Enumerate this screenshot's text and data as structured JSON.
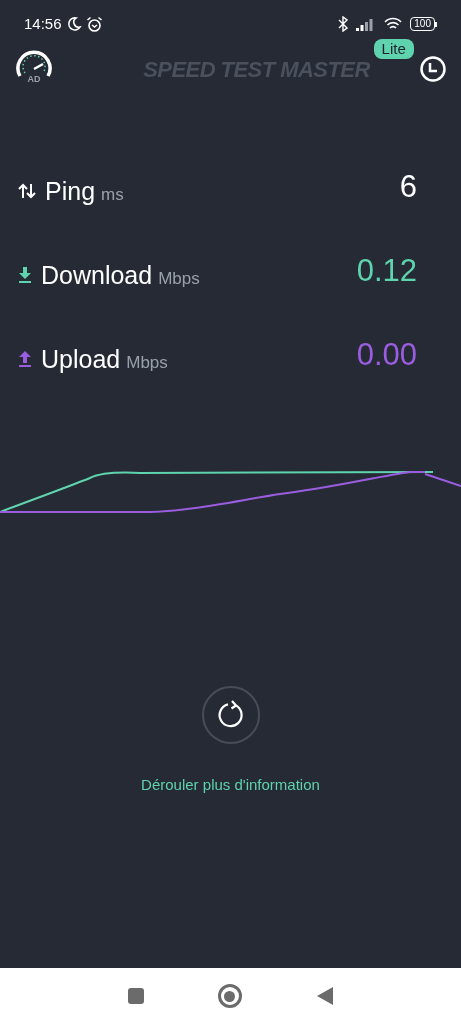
{
  "status_bar": {
    "time": "14:56",
    "battery": "100"
  },
  "header": {
    "ad_label": "AD",
    "logo": "SPEED TEST MASTER",
    "badge": "Lite"
  },
  "metrics": [
    {
      "kind": "ping",
      "label": "Ping",
      "unit": "ms",
      "value": "6",
      "color": "#ffffff"
    },
    {
      "kind": "download",
      "label": "Download",
      "unit": "Mbps",
      "value": "0.12",
      "color": "#5ed3ad"
    },
    {
      "kind": "upload",
      "label": "Upload",
      "unit": "Mbps",
      "value": "0.00",
      "color": "#9b5de0"
    }
  ],
  "more_info": "Dérouler plus d'information"
}
